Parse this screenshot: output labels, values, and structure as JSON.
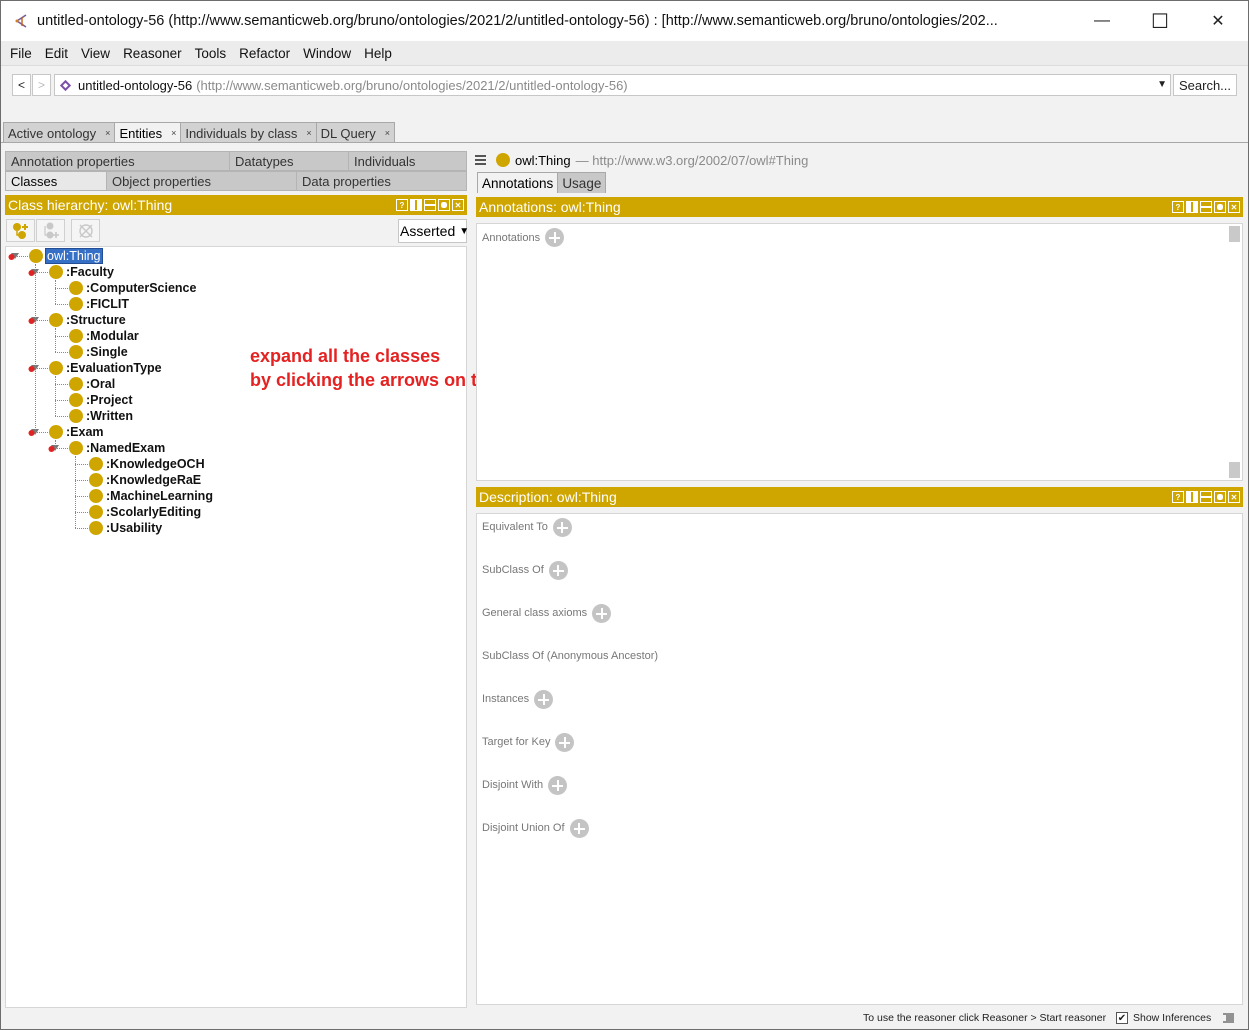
{
  "window": {
    "title": "untitled-ontology-56 (http://www.semanticweb.org/bruno/ontologies/2021/2/untitled-ontology-56)  : [http://www.semanticweb.org/bruno/ontologies/202...",
    "minimize_icon": "—",
    "maximize_icon": "☐",
    "close_icon": "✕"
  },
  "menu": [
    "File",
    "Edit",
    "View",
    "Reasoner",
    "Tools",
    "Refactor",
    "Window",
    "Help"
  ],
  "address": {
    "back": "<",
    "forward": ">",
    "ontology_name": "untitled-ontology-56",
    "ontology_iri": "(http://www.semanticweb.org/bruno/ontologies/2021/2/untitled-ontology-56)",
    "search_label": "Search..."
  },
  "main_tabs": [
    {
      "label": "Active ontology",
      "active": false
    },
    {
      "label": "Entities",
      "active": true
    },
    {
      "label": "Individuals by class",
      "active": false
    },
    {
      "label": "DL Query",
      "active": false
    }
  ],
  "tab_close": "×",
  "entity_tabs": {
    "row1": [
      "Annotation properties",
      "Datatypes",
      "Individuals"
    ],
    "row2": [
      "Classes",
      "Object properties",
      "Data properties"
    ],
    "active": "Classes"
  },
  "class_hierarchy": {
    "header": "Class hierarchy: owl:Thing",
    "view_mode": "Asserted",
    "tree": [
      {
        "label": "owl:Thing",
        "depth": 0,
        "selected": true,
        "expandable": true
      },
      {
        "label": ":Faculty",
        "depth": 1,
        "expandable": true
      },
      {
        "label": ":ComputerScience",
        "depth": 2
      },
      {
        "label": ":FICLIT",
        "depth": 2
      },
      {
        "label": ":Structure",
        "depth": 1,
        "expandable": true
      },
      {
        "label": ":Modular",
        "depth": 2
      },
      {
        "label": ":Single",
        "depth": 2
      },
      {
        "label": ":EvaluationType",
        "depth": 1,
        "expandable": true
      },
      {
        "label": ":Oral",
        "depth": 2
      },
      {
        "label": ":Project",
        "depth": 2
      },
      {
        "label": ":Written",
        "depth": 2
      },
      {
        "label": ":Exam",
        "depth": 1,
        "expandable": true
      },
      {
        "label": ":NamedExam",
        "depth": 2,
        "expandable": true
      },
      {
        "label": ":KnowledgeOCH",
        "depth": 3
      },
      {
        "label": ":KnowledgeRaE",
        "depth": 3
      },
      {
        "label": ":MachineLearning",
        "depth": 3
      },
      {
        "label": ":ScolarlyEditing",
        "depth": 3
      },
      {
        "label": ":Usability",
        "depth": 3
      }
    ]
  },
  "instruction_overlay": {
    "line1": "expand all the classes",
    "line2": "by clicking the arrows on their left",
    "color": "#e52222"
  },
  "entity": {
    "name": "owl:Thing",
    "iri": "— http://www.w3.org/2002/07/owl#Thing",
    "tabs": [
      {
        "label": "Annotations",
        "active": true
      },
      {
        "label": "Usage",
        "active": false
      }
    ]
  },
  "annotations_view": {
    "header": "Annotations: owl:Thing",
    "label": "Annotations"
  },
  "description_view": {
    "header": "Description: owl:Thing",
    "sections": [
      {
        "label": "Equivalent To",
        "add": true
      },
      {
        "label": "SubClass Of",
        "add": true
      },
      {
        "label": "General class axioms",
        "add": true
      },
      {
        "label": "SubClass Of (Anonymous Ancestor)",
        "add": false
      },
      {
        "label": "Instances",
        "add": true
      },
      {
        "label": "Target for Key",
        "add": true
      },
      {
        "label": "Disjoint With",
        "add": true
      },
      {
        "label": "Disjoint Union Of",
        "add": true
      }
    ]
  },
  "view_controls": [
    "?",
    "",
    "",
    "",
    "✕"
  ],
  "status_bar": {
    "message": "To use the reasoner click Reasoner > Start reasoner",
    "show_inferences_label": "Show Inferences",
    "show_inferences_checked": true,
    "check_mark": "✔"
  },
  "colors": {
    "view_header": "#cfa500",
    "class_dot": "#cfa500",
    "selection": "#3570c6",
    "expander": "#e52222"
  }
}
